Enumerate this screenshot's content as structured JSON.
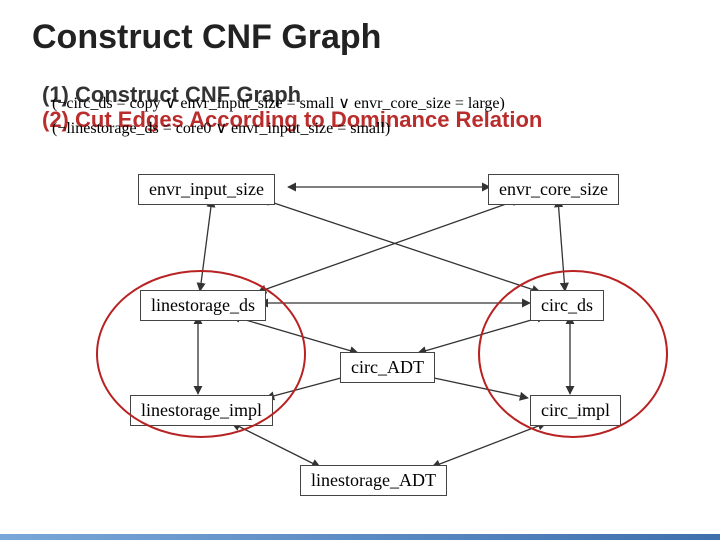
{
  "title": "Construct CNF Graph",
  "steps": {
    "s1": "(1) Construct CNF Graph",
    "s2": "(2) Cut Edges According to Dominance Relation"
  },
  "clauses": {
    "c1": "(¬circ_ds = copy ∨ envr_input_size = small ∨  envr_core_size = large)",
    "c2": "(¬linestorage_ds = core0 ∨ envr_input_size = small)"
  },
  "nodes": {
    "envr_input_size": "envr_input_size",
    "envr_core_size": "envr_core_size",
    "linestorage_ds": "linestorage_ds",
    "circ_ds": "circ_ds",
    "circ_adt": "circ_ADT",
    "linestorage_impl": "linestorage_impl",
    "circ_impl": "circ_impl",
    "linestorage_adt": "linestorage_ADT"
  }
}
